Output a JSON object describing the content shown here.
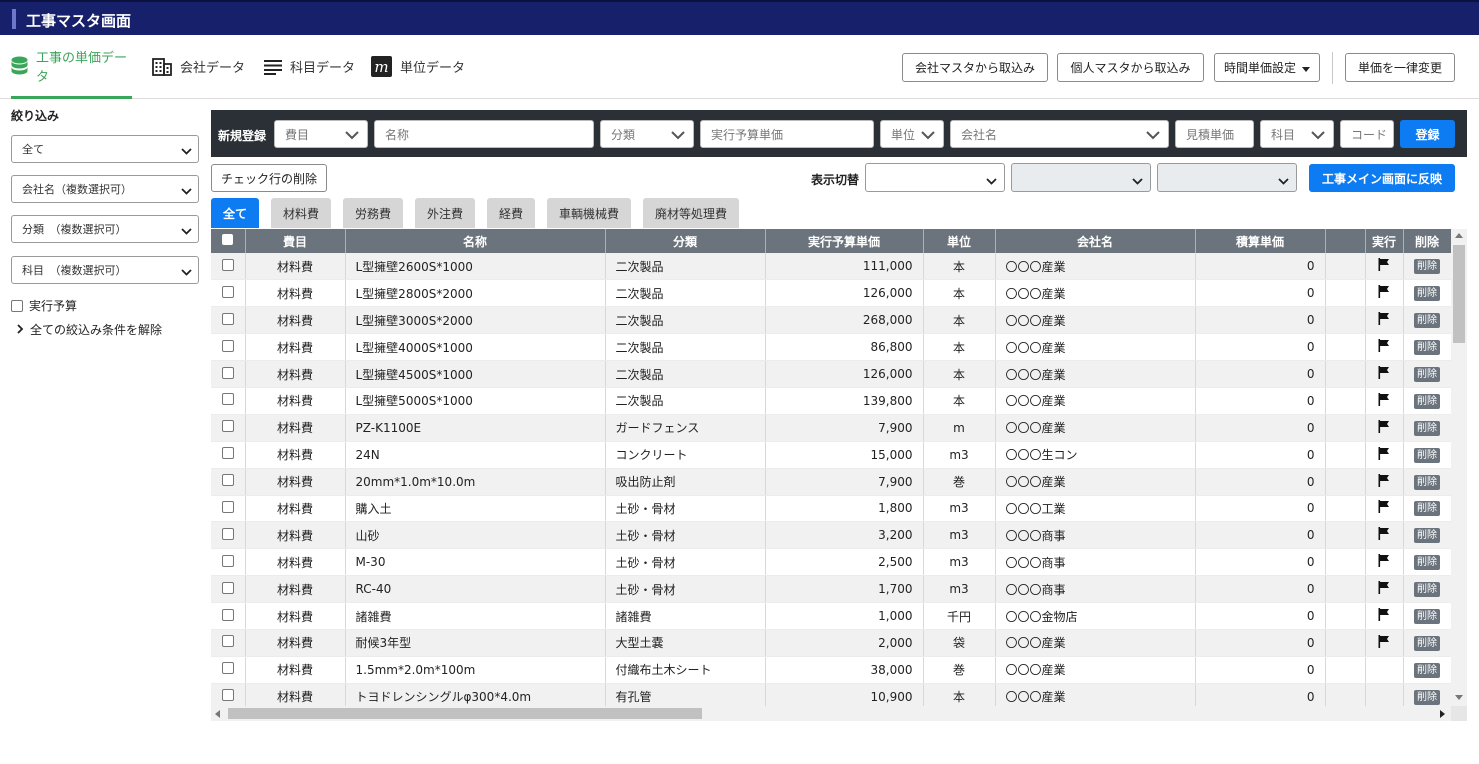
{
  "app": {
    "title": "工事マスタ画面"
  },
  "nav": {
    "tabs": [
      {
        "label": "工事の単価データ",
        "icon": "database-icon",
        "active": true
      },
      {
        "label": "会社データ",
        "icon": "building-icon"
      },
      {
        "label": "科目データ",
        "icon": "list-lines-icon"
      },
      {
        "label": "単位データ",
        "icon": "m-letter-icon"
      }
    ]
  },
  "toolbar": {
    "import_company_label": "会社マスタから取込み",
    "import_personal_label": "個人マスタから取込み",
    "hourly_setting_label": "時間単価設定",
    "bulk_change_label": "単価を一律変更"
  },
  "sidebar": {
    "title": "絞り込み",
    "filters": [
      "全て",
      "会社名（複数選択可）",
      "分類　（複数選択可）",
      "科目　（複数選択可）"
    ],
    "budget_checkbox_label": "実行予算",
    "clear_label": "全ての絞込み条件を解除"
  },
  "register": {
    "label": "新規登録",
    "fields": {
      "cost_type": "費目",
      "name": "名称",
      "category": "分類",
      "budget_price": "実行予算単価",
      "unit": "単位",
      "company": "会社名",
      "estimate_price": "見積単価",
      "subject": "科目",
      "code": "コード"
    },
    "submit_label": "登録"
  },
  "actions": {
    "delete_checked_label": "チェック行の削除",
    "display_switch_label": "表示切替",
    "reflect_label": "工事メイン画面に反映"
  },
  "category_tabs": [
    "全て",
    "材料費",
    "労務費",
    "外注費",
    "経費",
    "車輌機械費",
    "廃材等処理費"
  ],
  "table": {
    "headers": [
      "費目",
      "名称",
      "分類",
      "実行予算単価",
      "単位",
      "会社名",
      "積算単価",
      "",
      "実行",
      "削除"
    ],
    "delete_label": "削除",
    "rows": [
      {
        "cost": "材料費",
        "name": "L型擁壁2600S*1000",
        "category": "二次製品",
        "price": "111,000",
        "unit": "本",
        "company": "〇〇〇産業",
        "estimate": "0",
        "flag": true
      },
      {
        "cost": "材料費",
        "name": "L型擁壁2800S*2000",
        "category": "二次製品",
        "price": "126,000",
        "unit": "本",
        "company": "〇〇〇産業",
        "estimate": "0",
        "flag": true
      },
      {
        "cost": "材料費",
        "name": "L型擁壁3000S*2000",
        "category": "二次製品",
        "price": "268,000",
        "unit": "本",
        "company": "〇〇〇産業",
        "estimate": "0",
        "flag": true
      },
      {
        "cost": "材料費",
        "name": "L型擁壁4000S*1000",
        "category": "二次製品",
        "price": "86,800",
        "unit": "本",
        "company": "〇〇〇産業",
        "estimate": "0",
        "flag": true
      },
      {
        "cost": "材料費",
        "name": "L型擁壁4500S*1000",
        "category": "二次製品",
        "price": "126,000",
        "unit": "本",
        "company": "〇〇〇産業",
        "estimate": "0",
        "flag": true
      },
      {
        "cost": "材料費",
        "name": "L型擁壁5000S*1000",
        "category": "二次製品",
        "price": "139,800",
        "unit": "本",
        "company": "〇〇〇産業",
        "estimate": "0",
        "flag": true
      },
      {
        "cost": "材料費",
        "name": "PZ-K1100E",
        "category": "ガードフェンス",
        "price": "7,900",
        "unit": "m",
        "company": "〇〇〇産業",
        "estimate": "0",
        "flag": true
      },
      {
        "cost": "材料費",
        "name": "24N",
        "category": "コンクリート",
        "price": "15,000",
        "unit": "m3",
        "company": "〇〇〇生コン",
        "estimate": "0",
        "flag": true
      },
      {
        "cost": "材料費",
        "name": "20mm*1.0m*10.0m",
        "category": "吸出防止剤",
        "price": "7,900",
        "unit": "巻",
        "company": "〇〇〇産業",
        "estimate": "0",
        "flag": true
      },
      {
        "cost": "材料費",
        "name": "購入土",
        "category": "土砂・骨材",
        "price": "1,800",
        "unit": "m3",
        "company": "〇〇〇工業",
        "estimate": "0",
        "flag": true
      },
      {
        "cost": "材料費",
        "name": "山砂",
        "category": "土砂・骨材",
        "price": "3,200",
        "unit": "m3",
        "company": "〇〇〇商事",
        "estimate": "0",
        "flag": true
      },
      {
        "cost": "材料費",
        "name": "M-30",
        "category": "土砂・骨材",
        "price": "2,500",
        "unit": "m3",
        "company": "〇〇〇商事",
        "estimate": "0",
        "flag": true
      },
      {
        "cost": "材料費",
        "name": "RC-40",
        "category": "土砂・骨材",
        "price": "1,700",
        "unit": "m3",
        "company": "〇〇〇商事",
        "estimate": "0",
        "flag": true
      },
      {
        "cost": "材料費",
        "name": "諸雑費",
        "category": "諸雑費",
        "price": "1,000",
        "unit": "千円",
        "company": "〇〇〇金物店",
        "estimate": "0",
        "flag": true
      },
      {
        "cost": "材料費",
        "name": "耐候3年型",
        "category": "大型土嚢",
        "price": "2,000",
        "unit": "袋",
        "company": "〇〇〇産業",
        "estimate": "0",
        "flag": true
      },
      {
        "cost": "材料費",
        "name": "1.5mm*2.0m*100m",
        "category": "付織布土木シート",
        "price": "38,000",
        "unit": "巻",
        "company": "〇〇〇産業",
        "estimate": "0",
        "flag": false
      },
      {
        "cost": "材料費",
        "name": "トヨドレンシングルφ300*4.0m",
        "category": "有孔管",
        "price": "10,900",
        "unit": "本",
        "company": "〇〇〇産業",
        "estimate": "0",
        "flag": false
      }
    ]
  },
  "colors": {
    "header_bg": "#16206b",
    "accent_green": "#3aa65a",
    "primary_blue": "#0d7bf2",
    "table_header": "#6b737c"
  }
}
